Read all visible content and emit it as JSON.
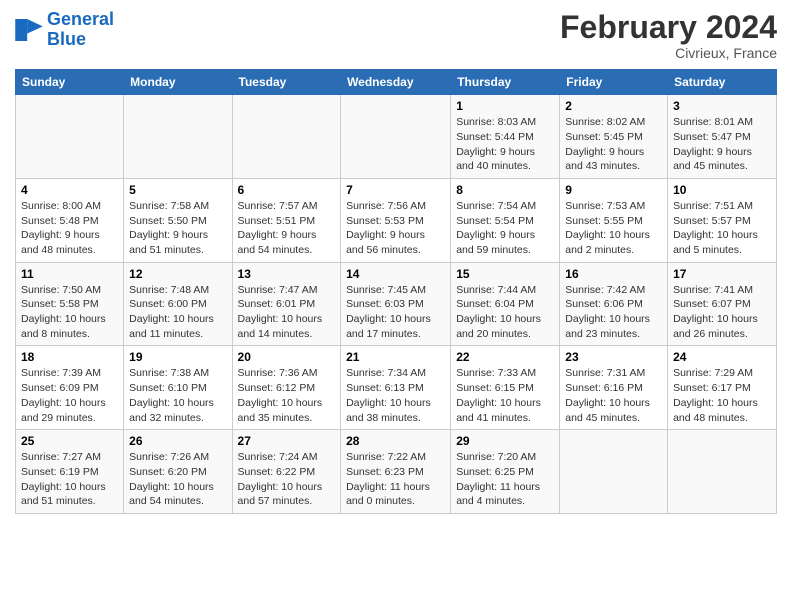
{
  "header": {
    "logo_line1": "General",
    "logo_line2": "Blue",
    "title": "February 2024",
    "subtitle": "Civrieux, France"
  },
  "weekdays": [
    "Sunday",
    "Monday",
    "Tuesday",
    "Wednesday",
    "Thursday",
    "Friday",
    "Saturday"
  ],
  "weeks": [
    [
      {
        "day": "",
        "info": ""
      },
      {
        "day": "",
        "info": ""
      },
      {
        "day": "",
        "info": ""
      },
      {
        "day": "",
        "info": ""
      },
      {
        "day": "1",
        "info": "Sunrise: 8:03 AM\nSunset: 5:44 PM\nDaylight: 9 hours\nand 40 minutes."
      },
      {
        "day": "2",
        "info": "Sunrise: 8:02 AM\nSunset: 5:45 PM\nDaylight: 9 hours\nand 43 minutes."
      },
      {
        "day": "3",
        "info": "Sunrise: 8:01 AM\nSunset: 5:47 PM\nDaylight: 9 hours\nand 45 minutes."
      }
    ],
    [
      {
        "day": "4",
        "info": "Sunrise: 8:00 AM\nSunset: 5:48 PM\nDaylight: 9 hours\nand 48 minutes."
      },
      {
        "day": "5",
        "info": "Sunrise: 7:58 AM\nSunset: 5:50 PM\nDaylight: 9 hours\nand 51 minutes."
      },
      {
        "day": "6",
        "info": "Sunrise: 7:57 AM\nSunset: 5:51 PM\nDaylight: 9 hours\nand 54 minutes."
      },
      {
        "day": "7",
        "info": "Sunrise: 7:56 AM\nSunset: 5:53 PM\nDaylight: 9 hours\nand 56 minutes."
      },
      {
        "day": "8",
        "info": "Sunrise: 7:54 AM\nSunset: 5:54 PM\nDaylight: 9 hours\nand 59 minutes."
      },
      {
        "day": "9",
        "info": "Sunrise: 7:53 AM\nSunset: 5:55 PM\nDaylight: 10 hours\nand 2 minutes."
      },
      {
        "day": "10",
        "info": "Sunrise: 7:51 AM\nSunset: 5:57 PM\nDaylight: 10 hours\nand 5 minutes."
      }
    ],
    [
      {
        "day": "11",
        "info": "Sunrise: 7:50 AM\nSunset: 5:58 PM\nDaylight: 10 hours\nand 8 minutes."
      },
      {
        "day": "12",
        "info": "Sunrise: 7:48 AM\nSunset: 6:00 PM\nDaylight: 10 hours\nand 11 minutes."
      },
      {
        "day": "13",
        "info": "Sunrise: 7:47 AM\nSunset: 6:01 PM\nDaylight: 10 hours\nand 14 minutes."
      },
      {
        "day": "14",
        "info": "Sunrise: 7:45 AM\nSunset: 6:03 PM\nDaylight: 10 hours\nand 17 minutes."
      },
      {
        "day": "15",
        "info": "Sunrise: 7:44 AM\nSunset: 6:04 PM\nDaylight: 10 hours\nand 20 minutes."
      },
      {
        "day": "16",
        "info": "Sunrise: 7:42 AM\nSunset: 6:06 PM\nDaylight: 10 hours\nand 23 minutes."
      },
      {
        "day": "17",
        "info": "Sunrise: 7:41 AM\nSunset: 6:07 PM\nDaylight: 10 hours\nand 26 minutes."
      }
    ],
    [
      {
        "day": "18",
        "info": "Sunrise: 7:39 AM\nSunset: 6:09 PM\nDaylight: 10 hours\nand 29 minutes."
      },
      {
        "day": "19",
        "info": "Sunrise: 7:38 AM\nSunset: 6:10 PM\nDaylight: 10 hours\nand 32 minutes."
      },
      {
        "day": "20",
        "info": "Sunrise: 7:36 AM\nSunset: 6:12 PM\nDaylight: 10 hours\nand 35 minutes."
      },
      {
        "day": "21",
        "info": "Sunrise: 7:34 AM\nSunset: 6:13 PM\nDaylight: 10 hours\nand 38 minutes."
      },
      {
        "day": "22",
        "info": "Sunrise: 7:33 AM\nSunset: 6:15 PM\nDaylight: 10 hours\nand 41 minutes."
      },
      {
        "day": "23",
        "info": "Sunrise: 7:31 AM\nSunset: 6:16 PM\nDaylight: 10 hours\nand 45 minutes."
      },
      {
        "day": "24",
        "info": "Sunrise: 7:29 AM\nSunset: 6:17 PM\nDaylight: 10 hours\nand 48 minutes."
      }
    ],
    [
      {
        "day": "25",
        "info": "Sunrise: 7:27 AM\nSunset: 6:19 PM\nDaylight: 10 hours\nand 51 minutes."
      },
      {
        "day": "26",
        "info": "Sunrise: 7:26 AM\nSunset: 6:20 PM\nDaylight: 10 hours\nand 54 minutes."
      },
      {
        "day": "27",
        "info": "Sunrise: 7:24 AM\nSunset: 6:22 PM\nDaylight: 10 hours\nand 57 minutes."
      },
      {
        "day": "28",
        "info": "Sunrise: 7:22 AM\nSunset: 6:23 PM\nDaylight: 11 hours\nand 0 minutes."
      },
      {
        "day": "29",
        "info": "Sunrise: 7:20 AM\nSunset: 6:25 PM\nDaylight: 11 hours\nand 4 minutes."
      },
      {
        "day": "",
        "info": ""
      },
      {
        "day": "",
        "info": ""
      }
    ]
  ]
}
